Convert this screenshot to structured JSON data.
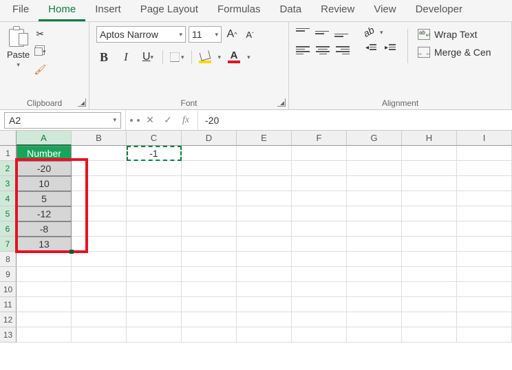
{
  "tabs": [
    "File",
    "Home",
    "Insert",
    "Page Layout",
    "Formulas",
    "Data",
    "Review",
    "View",
    "Developer"
  ],
  "active_tab": 1,
  "ribbon": {
    "clipboard": {
      "title": "Clipboard",
      "paste": "Paste"
    },
    "font": {
      "title": "Font",
      "name": "Aptos Narrow",
      "size": "11",
      "bold": "B",
      "italic": "I",
      "underline": "U",
      "increase": "A",
      "decrease": "A"
    },
    "alignment": {
      "title": "Alignment",
      "wrap": "Wrap Text",
      "merge": "Merge & Cen",
      "orient": "ab"
    }
  },
  "formula_bar": {
    "name_box": "A2",
    "fx": "fx",
    "value": " -20"
  },
  "grid": {
    "columns": [
      "A",
      "B",
      "C",
      "D",
      "E",
      "F",
      "G",
      "H",
      "I"
    ],
    "rows": 13,
    "header_cell": "Number",
    "data": [
      "-20",
      "10",
      "5",
      "-12",
      "-8",
      "13"
    ],
    "c1_value": "-1",
    "selected_rows": [
      2,
      3,
      4,
      5,
      6,
      7
    ],
    "selected_col": "A"
  },
  "chart_data": {
    "type": "table",
    "title": "Number",
    "categories": [
      "row2",
      "row3",
      "row4",
      "row5",
      "row6",
      "row7"
    ],
    "values": [
      -20,
      10,
      5,
      -12,
      -8,
      13
    ],
    "aux": {
      "C1": -1
    }
  }
}
